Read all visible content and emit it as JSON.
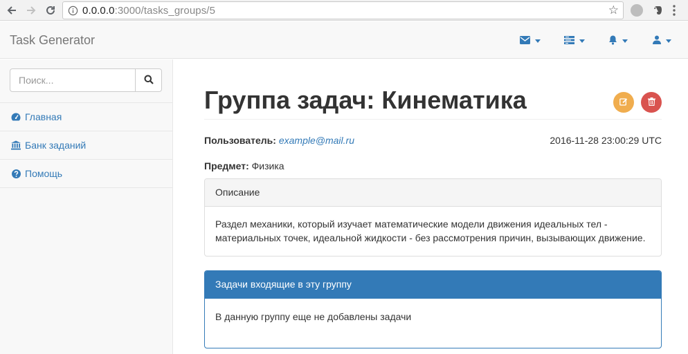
{
  "browser": {
    "url_host": "0.0.0.0",
    "url_path": ":3000/tasks_groups/5"
  },
  "navbar": {
    "brand": "Task Generator",
    "menus": [
      {
        "icon": "envelope-icon"
      },
      {
        "icon": "tasks-icon"
      },
      {
        "icon": "bell-icon"
      },
      {
        "icon": "user-icon"
      }
    ],
    "accent": "#337ab7"
  },
  "sidebar": {
    "search_placeholder": "Поиск...",
    "items": [
      {
        "label": "Главная",
        "icon": "dashboard-icon"
      },
      {
        "label": "Банк заданий",
        "icon": "bank-icon"
      },
      {
        "label": "Помощь",
        "icon": "question-circle-icon"
      }
    ]
  },
  "main": {
    "title_bold": "Группа задач:",
    "title_rest": "Кинематика",
    "user_label": "Пользователь:",
    "user_email": "example@mail.ru",
    "timestamp": "2016-11-28 23:00:29 UTC",
    "subject_label": "Предмет:",
    "subject_value": "Физика",
    "description_heading": "Описание",
    "description_text": "Раздел механики, который изучает математические модели движения идеальных тел - материальных точек, идеальной жидкости - без рассмотрения причин, вызывающих движение.",
    "tasks_heading": "Задачи входящие в эту группу",
    "tasks_empty": "В данную группу еще не добавлены задачи",
    "edit_color": "#f0ad4e",
    "delete_color": "#d9534f"
  }
}
